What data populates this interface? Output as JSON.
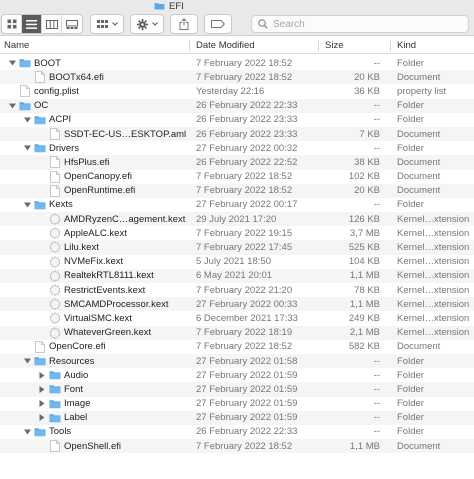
{
  "window": {
    "title": "EFI"
  },
  "toolbar": {
    "search_placeholder": "Search",
    "view_buttons": [
      "icon-view",
      "list-view",
      "column-view",
      "gallery-view"
    ],
    "group_button": "group-by-grid",
    "action_button": "gear-action",
    "share_button": "share",
    "tag_button": "tag"
  },
  "columns": {
    "name": "Name",
    "date": "Date Modified",
    "size": "Size",
    "kind": "Kind"
  },
  "rows": [
    {
      "level": 0,
      "name": "BOOT",
      "type": "folder",
      "open": true,
      "date": "7 February 2022 18:52",
      "size": "--",
      "kind": "Folder"
    },
    {
      "level": 1,
      "name": "BOOTx64.efi",
      "type": "file",
      "date": "7 February 2022 18:52",
      "size": "20 KB",
      "kind": "Document"
    },
    {
      "level": 0,
      "name": "config.plist",
      "type": "file",
      "date": "Yesterday 22:16",
      "size": "36 KB",
      "kind": "property list"
    },
    {
      "level": 0,
      "name": "OC",
      "type": "folder",
      "open": true,
      "date": "26 February 2022 22:33",
      "size": "--",
      "kind": "Folder"
    },
    {
      "level": 1,
      "name": "ACPI",
      "type": "folder",
      "open": true,
      "date": "26 February 2022 23:33",
      "size": "--",
      "kind": "Folder"
    },
    {
      "level": 2,
      "name": "SSDT-EC-US…ESKTOP.aml",
      "type": "file",
      "date": "26 February 2022 23:33",
      "size": "7 KB",
      "kind": "Document"
    },
    {
      "level": 1,
      "name": "Drivers",
      "type": "folder",
      "open": true,
      "date": "27 February 2022 00:32",
      "size": "--",
      "kind": "Folder"
    },
    {
      "level": 2,
      "name": "HfsPlus.efi",
      "type": "file",
      "date": "26 February 2022 22:52",
      "size": "38 KB",
      "kind": "Document"
    },
    {
      "level": 2,
      "name": "OpenCanopy.efi",
      "type": "file",
      "date": "7 February 2022 18:52",
      "size": "102 KB",
      "kind": "Document"
    },
    {
      "level": 2,
      "name": "OpenRuntime.efi",
      "type": "file",
      "date": "7 February 2022 18:52",
      "size": "20 KB",
      "kind": "Document"
    },
    {
      "level": 1,
      "name": "Kexts",
      "type": "folder",
      "open": true,
      "date": "27 February 2022 00:17",
      "size": "--",
      "kind": "Folder"
    },
    {
      "level": 2,
      "name": "AMDRyzenC…agement.kext",
      "type": "kext",
      "date": "29 July 2021 17:20",
      "size": "126 KB",
      "kind": "Kernel…xtension"
    },
    {
      "level": 2,
      "name": "AppleALC.kext",
      "type": "kext",
      "date": "7 February 2022 19:15",
      "size": "3,7 MB",
      "kind": "Kernel…xtension"
    },
    {
      "level": 2,
      "name": "Lilu.kext",
      "type": "kext",
      "date": "7 February 2022 17:45",
      "size": "525 KB",
      "kind": "Kernel…xtension"
    },
    {
      "level": 2,
      "name": "NVMeFix.kext",
      "type": "kext",
      "date": "5 July 2021 18:50",
      "size": "104 KB",
      "kind": "Kernel…xtension"
    },
    {
      "level": 2,
      "name": "RealtekRTL8111.kext",
      "type": "kext",
      "date": "6 May 2021 20:01",
      "size": "1,1 MB",
      "kind": "Kernel…xtension"
    },
    {
      "level": 2,
      "name": "RestrictEvents.kext",
      "type": "kext",
      "date": "7 February 2022 21:20",
      "size": "78 KB",
      "kind": "Kernel…xtension"
    },
    {
      "level": 2,
      "name": "SMCAMDProcessor.kext",
      "type": "kext",
      "date": "27 February 2022 00:33",
      "size": "1,1 MB",
      "kind": "Kernel…xtension"
    },
    {
      "level": 2,
      "name": "VirtualSMC.kext",
      "type": "kext",
      "date": "6 December 2021 17:33",
      "size": "249 KB",
      "kind": "Kernel…xtension"
    },
    {
      "level": 2,
      "name": "WhateverGreen.kext",
      "type": "kext",
      "date": "7 February 2022 18:19",
      "size": "2,1 MB",
      "kind": "Kernel…xtension"
    },
    {
      "level": 1,
      "name": "OpenCore.efi",
      "type": "file",
      "date": "7 February 2022 18:52",
      "size": "582 KB",
      "kind": "Document"
    },
    {
      "level": 1,
      "name": "Resources",
      "type": "folder",
      "open": true,
      "date": "27 February 2022 01:58",
      "size": "--",
      "kind": "Folder"
    },
    {
      "level": 2,
      "name": "Audio",
      "type": "folder",
      "open": false,
      "date": "27 February 2022 01:59",
      "size": "--",
      "kind": "Folder"
    },
    {
      "level": 2,
      "name": "Font",
      "type": "folder",
      "open": false,
      "date": "27 February 2022 01:59",
      "size": "--",
      "kind": "Folder"
    },
    {
      "level": 2,
      "name": "Image",
      "type": "folder",
      "open": false,
      "date": "27 February 2022 01:59",
      "size": "--",
      "kind": "Folder"
    },
    {
      "level": 2,
      "name": "Label",
      "type": "folder",
      "open": false,
      "date": "27 February 2022 01:59",
      "size": "--",
      "kind": "Folder"
    },
    {
      "level": 1,
      "name": "Tools",
      "type": "folder",
      "open": true,
      "date": "26 February 2022 22:33",
      "size": "--",
      "kind": "Folder"
    },
    {
      "level": 2,
      "name": "OpenShell.efi",
      "type": "file",
      "date": "7 February 2022 18:52",
      "size": "1,1 MB",
      "kind": "Document"
    }
  ],
  "colors": {
    "folder": "#5aa9e6",
    "folder_tab": "#4a98d8",
    "header_bg": "#e9e9e9",
    "alt_row": "#f4f5f5",
    "muted_text": "#777777"
  }
}
